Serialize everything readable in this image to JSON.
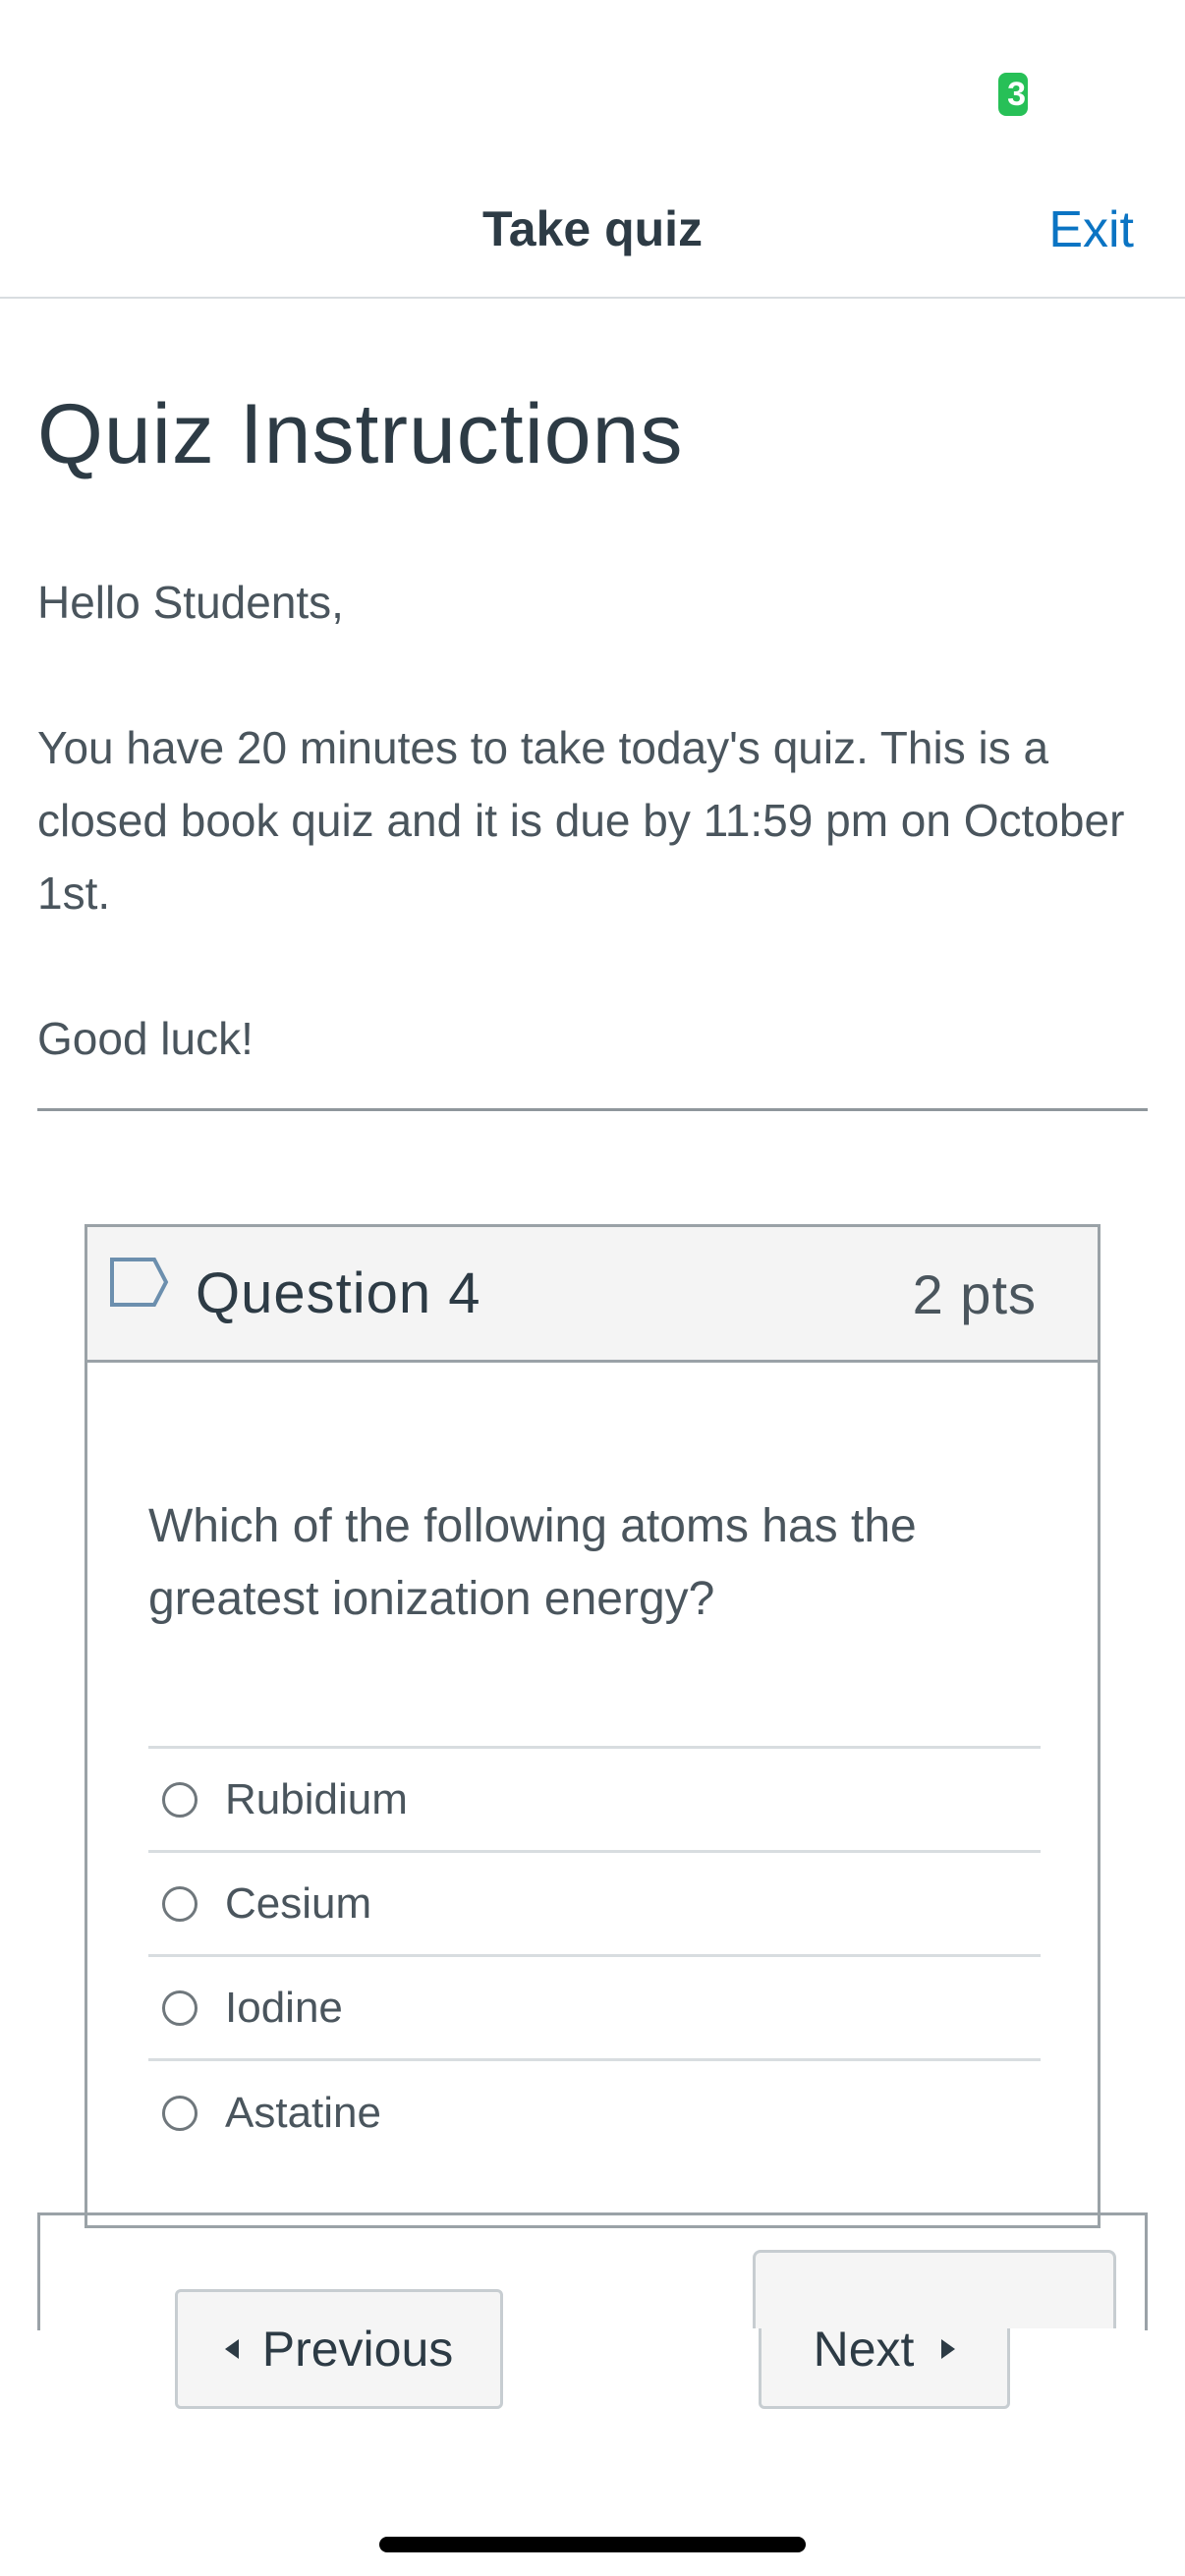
{
  "status_bar": {
    "badge_text": "3"
  },
  "nav": {
    "title": "Take quiz",
    "exit_label": "Exit"
  },
  "instructions": {
    "title": "Quiz Instructions",
    "greeting": "Hello Students,",
    "body": "You have 20 minutes to take today's quiz. This is a closed book quiz and it is due by 11:59 pm on October 1st.",
    "closing": "Good luck!"
  },
  "question": {
    "title": "Question 4",
    "points": "2 pts",
    "text": "Which of the following atoms has the greatest ionization energy?",
    "answers": [
      {
        "label": "Rubidium"
      },
      {
        "label": "Cesium"
      },
      {
        "label": "Iodine"
      },
      {
        "label": "Astatine"
      }
    ]
  },
  "navigation": {
    "previous_label": "Previous",
    "next_label": "Next"
  },
  "colors": {
    "accent": "#0b74c3",
    "badge": "#27c057",
    "text": "#2d3b45"
  }
}
